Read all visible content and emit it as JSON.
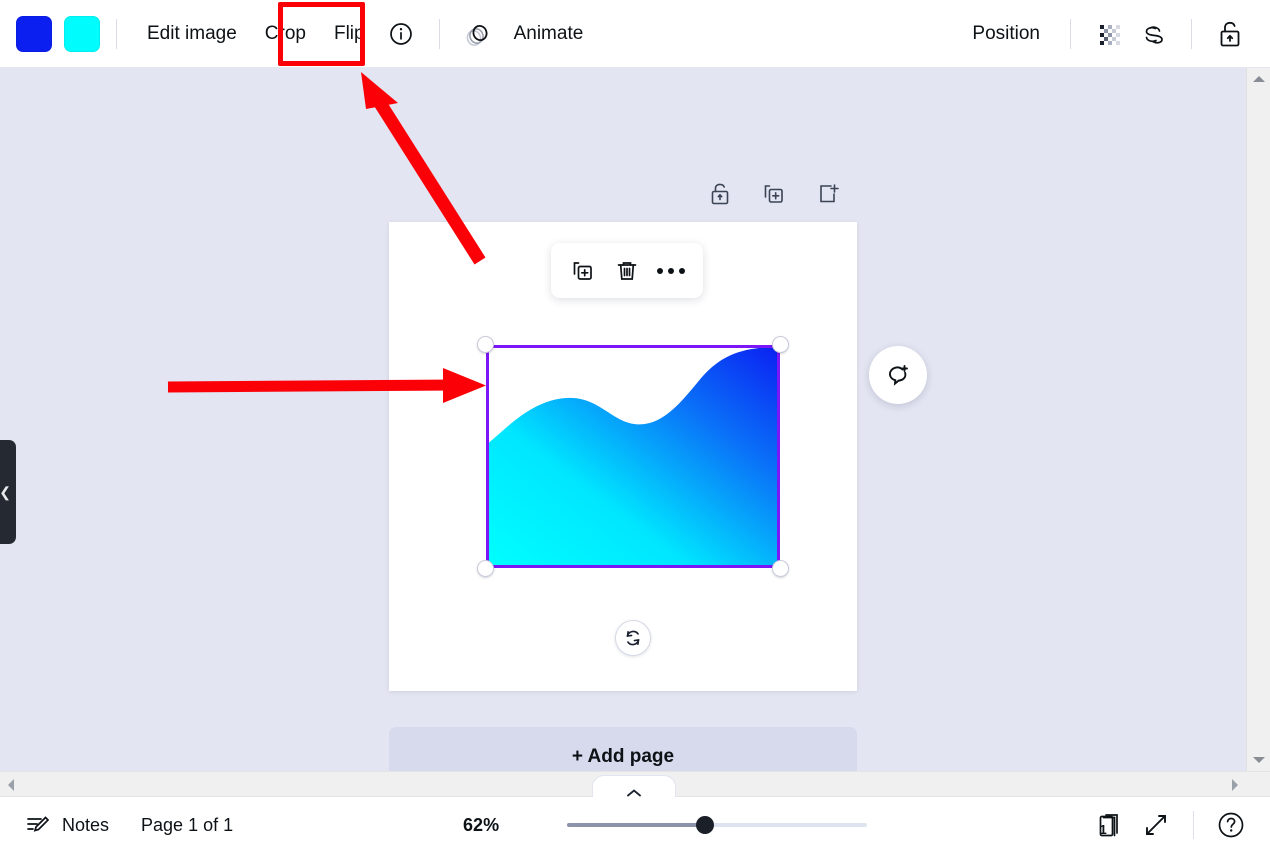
{
  "toolbar": {
    "swatches": [
      {
        "name": "color-swatch-blue",
        "hex": "#0B1FF0"
      },
      {
        "name": "color-swatch-cyan",
        "hex": "#00FCFC"
      }
    ],
    "edit_image_label": "Edit image",
    "crop_label": "Crop",
    "flip_label": "Flip",
    "info_icon": "info-icon",
    "animate_icon": "animate-icon",
    "animate_label": "Animate",
    "position_label": "Position",
    "transparency_icon": "transparency-checkerboard-icon",
    "link_icon": "link-icon",
    "lock_icon": "unlock-icon",
    "highlight_color": "#FB0007"
  },
  "canvas": {
    "background": "#E3E5F2",
    "collapse_handle_icon": "chevron-left-icon",
    "page_icons": [
      {
        "name": "page-lock-icon",
        "label": "Lock page"
      },
      {
        "name": "page-duplicate-icon",
        "label": "Duplicate page"
      },
      {
        "name": "page-add-icon",
        "label": "Add page"
      }
    ],
    "object_toolbar": [
      {
        "name": "duplicate-object-icon",
        "label": "Duplicate"
      },
      {
        "name": "delete-object-icon",
        "label": "Delete"
      },
      {
        "name": "more-options-icon",
        "label": "More"
      }
    ],
    "selection": {
      "border_color": "#7B16F7",
      "handle_count": 4,
      "rotate_icon": "rotate-icon"
    },
    "image": {
      "name": "wave-gradient-image",
      "gradient_from": "#00FFFF",
      "gradient_to": "#0B2BF5"
    },
    "comment_icon": "add-comment-icon",
    "add_page_label": "+ Add page"
  },
  "annotations": {
    "arrow_color": "#FB0007",
    "arrow_to_crop": "diagonal-arrow-to-crop-button",
    "arrow_to_image": "horizontal-arrow-to-image"
  },
  "scrollbars": {
    "v_up_icon": "scroll-up-arrow",
    "v_down_icon": "scroll-down-arrow",
    "h_left_icon": "scroll-left-arrow",
    "h_right_icon": "scroll-right-arrow",
    "panel_tab_icon": "chevron-up-icon"
  },
  "bottombar": {
    "notes_icon": "notes-icon",
    "notes_label": "Notes",
    "page_indicator": "Page 1 of 1",
    "zoom_level": "62%",
    "zoom_slider_value": 46,
    "pages_icon": "page-manager-icon",
    "pages_badge": "1",
    "fullscreen_icon": "fullscreen-icon",
    "help_icon": "help-icon"
  }
}
